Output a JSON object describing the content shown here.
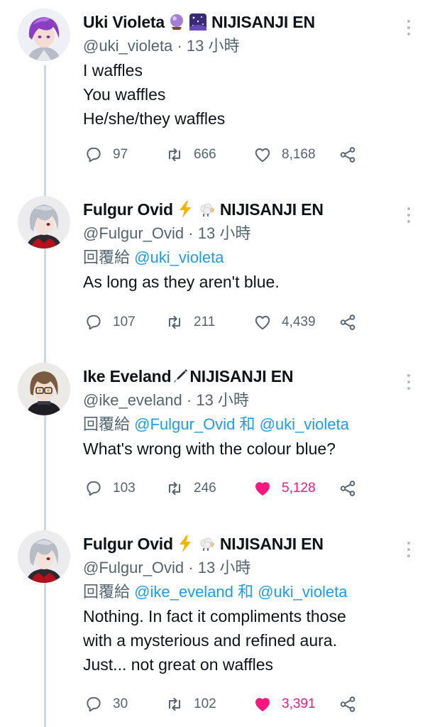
{
  "tweets": [
    {
      "name": "Uki Violeta",
      "emojis": [
        "crystal-ball",
        "night-sky"
      ],
      "org": "NIJISANJI EN",
      "handle": "@uki_violeta",
      "time": "· 13 小時",
      "reply_prefix": "",
      "mentions": [],
      "text": [
        "I waffles",
        "You waffles",
        "He/she/they waffles"
      ],
      "replies": "97",
      "retweets": "666",
      "likes": "8,168",
      "liked": false
    },
    {
      "name": "Fulgur Ovid",
      "emojis": [
        "lightning",
        "sheep"
      ],
      "org": "NIJISANJI EN",
      "handle": "@Fulgur_Ovid",
      "time": "· 13 小時",
      "reply_prefix": "回覆給",
      "mentions": [
        "@uki_violeta"
      ],
      "text": [
        "As long as they aren't blue."
      ],
      "replies": "107",
      "retweets": "211",
      "likes": "4,439",
      "liked": false
    },
    {
      "name": "Ike Eveland",
      "emojis": [
        "fountain-pen"
      ],
      "org": "NIJISANJI EN",
      "handle": "@ike_eveland",
      "time": "· 13 小時",
      "reply_prefix": "回覆給",
      "mentions": [
        "@Fulgur_Ovid",
        "和",
        "@uki_violeta"
      ],
      "text": [
        "What's wrong with the colour blue?"
      ],
      "replies": "103",
      "retweets": "246",
      "likes": "5,128",
      "liked": true
    },
    {
      "name": "Fulgur Ovid",
      "emojis": [
        "lightning",
        "sheep"
      ],
      "org": "NIJISANJI EN",
      "handle": "@Fulgur_Ovid",
      "time": "· 13 小時",
      "reply_prefix": "回覆給",
      "mentions": [
        "@ike_eveland",
        "和",
        "@uki_violeta"
      ],
      "text": [
        "Nothing. In fact it compliments those",
        "with a mysterious and refined aura.",
        "Just... not great on waffles"
      ],
      "replies": "30",
      "retweets": "102",
      "likes": "3,391",
      "liked": true
    }
  ],
  "colors": {
    "text": "#0f1419",
    "secondary": "#536471",
    "link": "#1d9bf0",
    "like": "#f91880",
    "thread_line": "#cfd9de"
  }
}
